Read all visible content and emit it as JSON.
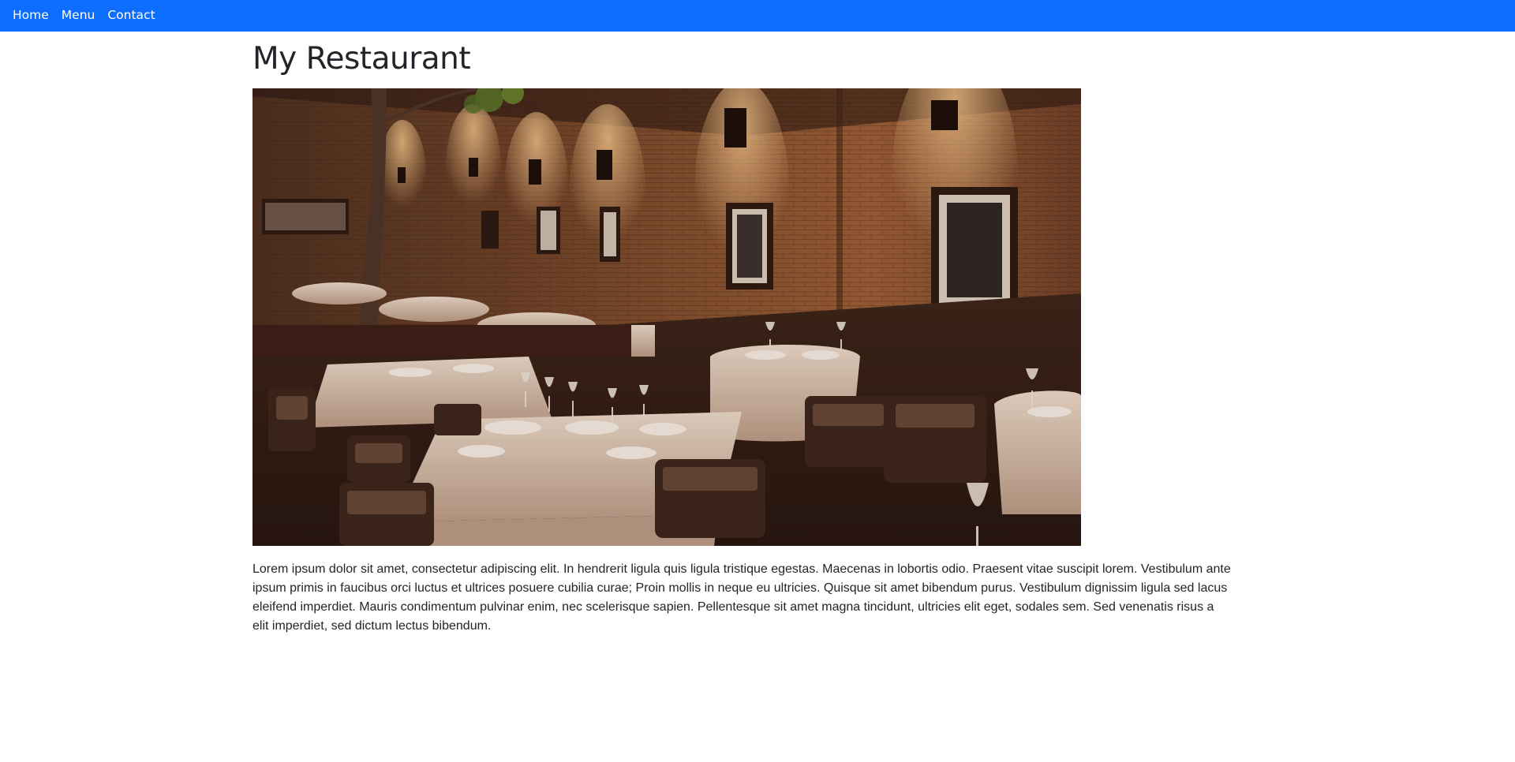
{
  "nav": {
    "items": [
      {
        "label": "Home"
      },
      {
        "label": "Menu"
      },
      {
        "label": "Contact"
      }
    ]
  },
  "main": {
    "title": "My Restaurant",
    "paragraph": "Lorem ipsum dolor sit amet, consectetur adipiscing elit. In hendrerit ligula quis ligula tristique egestas. Maecenas in lobortis odio. Praesent vitae suscipit lorem. Vestibulum ante ipsum primis in faucibus orci luctus et ultrices posuere cubilia curae; Proin mollis in neque eu ultricies. Quisque sit amet bibendum purus. Vestibulum dignissim ligula sed lacus eleifend imperdiet. Mauris condimentum pulvinar enim, nec scelerisque sapien. Pellentesque sit amet magna tincidunt, ultricies elit eget, sodales sem. Sed venenatis risus a elit imperdiet, sed dictum lectus bibendum."
  },
  "colors": {
    "navbar": "#0d6efd",
    "nav_text": "#ffffff",
    "text": "#212529"
  }
}
